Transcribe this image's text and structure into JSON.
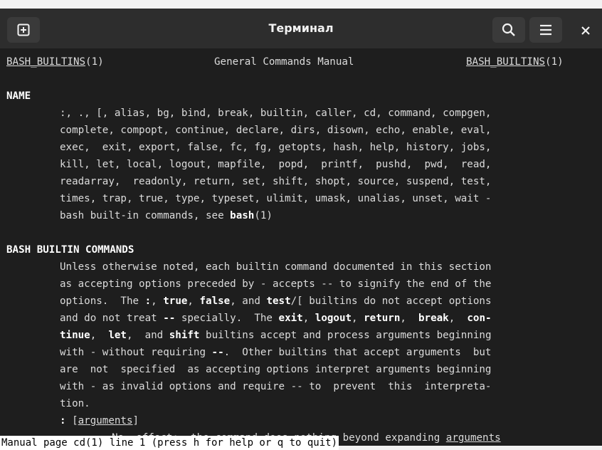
{
  "window": {
    "title": "Терминал",
    "new_tab_icon": "plus-box-icon",
    "search_icon": "search-icon",
    "menu_icon": "hamburger-menu-icon",
    "close_icon": "close-icon"
  },
  "man": {
    "header_left_name": "BASH_BUILTINS",
    "header_left_sec": "(1)",
    "header_center": "General Commands Manual",
    "header_right_name": "BASH_BUILTINS",
    "header_right_sec": "(1)",
    "name_heading": "NAME",
    "name_lines": [
      ":, ., [, alias, bg, bind, break, builtin, caller, cd, command, compgen,",
      "complete, compopt, continue, declare, dirs, disown, echo, enable, eval,",
      "exec,  exit, export, false, fc, fg, getopts, hash, help, history, jobs,",
      "kill, let, local, logout, mapfile,  popd,  printf,  pushd,  pwd,  read,",
      "readarray,  readonly, return, set, shift, shopt, source, suspend, test,",
      "times, trap, true, type, typeset, ulimit, umask, unalias, unset, wait -"
    ],
    "name_last_prefix": "bash built-in commands, see ",
    "name_last_bold": "bash",
    "name_last_suffix": "(1)",
    "builtins_heading": "BASH BUILTIN COMMANDS",
    "b1": "Unless otherwise noted, each builtin command documented in this section",
    "b2": "as accepting options preceded by - accepts -- to signify the end of the",
    "b3_a": "options.  The ",
    "b3_colon": ":",
    "b3_b": ", ",
    "b3_true": "true",
    "b3_c": ", ",
    "b3_false": "false",
    "b3_d": ", and ",
    "b3_test": "test",
    "b3_e": "/[ builtins do not accept options",
    "b4_a": "and do not treat ",
    "b4_dd": "--",
    "b4_b": " specially.  The ",
    "b4_exit": "exit",
    "b4_c": ", ",
    "b4_logout": "logout",
    "b4_d": ", ",
    "b4_return": "return",
    "b4_e": ",  ",
    "b4_break": "break",
    "b4_f": ",  ",
    "b4_con": "con-",
    "b5_tinue": "tinue",
    "b5_a": ",  ",
    "b5_let": "let",
    "b5_b": ",  and ",
    "b5_shift": "shift",
    "b5_c": " builtins accept and process arguments beginning",
    "b6_a": "with - without requiring ",
    "b6_dd": "--",
    "b6_b": ".  Other builtins that accept arguments  but",
    "b7": "are  not  specified  as accepting options interpret arguments beginning",
    "b8": "with - as invalid options and require -- to  prevent  this  interpreta-",
    "b9": "tion.",
    "colon_cmd": ":",
    "colon_open": " [",
    "colon_arg": "arguments",
    "colon_close": "]",
    "colon_desc_prefix": "No  effect;  the command does nothing beyond expanding ",
    "colon_desc_arg": "arguments",
    "status": "Manual page cd(1) line 1 (press h for help or q to quit)"
  }
}
